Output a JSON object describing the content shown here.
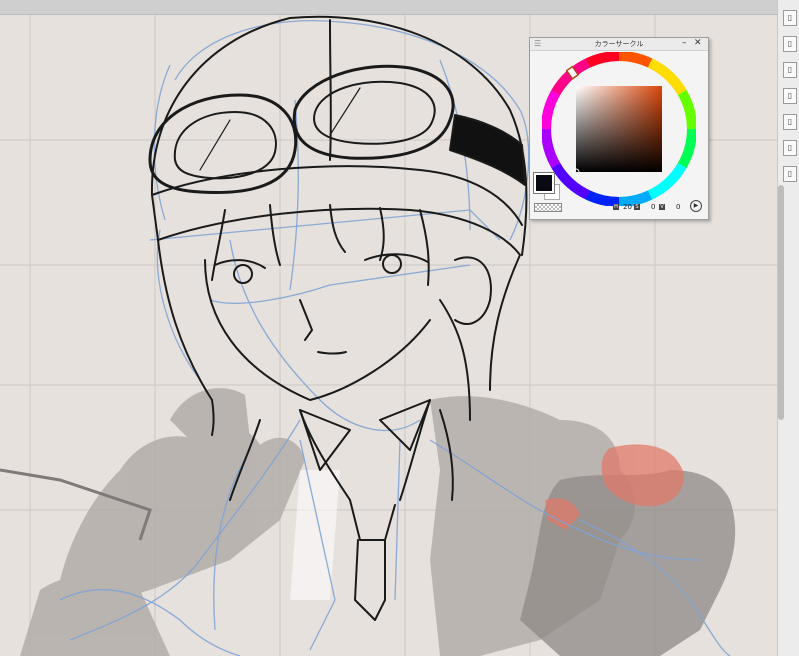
{
  "palette": {
    "title": "カラーサークル",
    "hue_value": "20",
    "saturation_value": "0",
    "brightness_value": "0",
    "hue_label": "H",
    "saturation_label": "S",
    "brightness_label": "V",
    "main_color": "#0a0a14",
    "sub_color": "#ffffff",
    "selected_hue_color": "#d9460a"
  },
  "icons": {
    "grip": "grip-icon",
    "minimize": "minimize-icon",
    "close": "close-icon",
    "swap": "play-circle-icon"
  },
  "colors": {
    "canvas_background": "#e6e1dd",
    "sketch_line": "#1a1a1a",
    "rough_line": "#7fa3d6",
    "shading": "#b3adaa",
    "accent_red": "#e07a6a"
  }
}
